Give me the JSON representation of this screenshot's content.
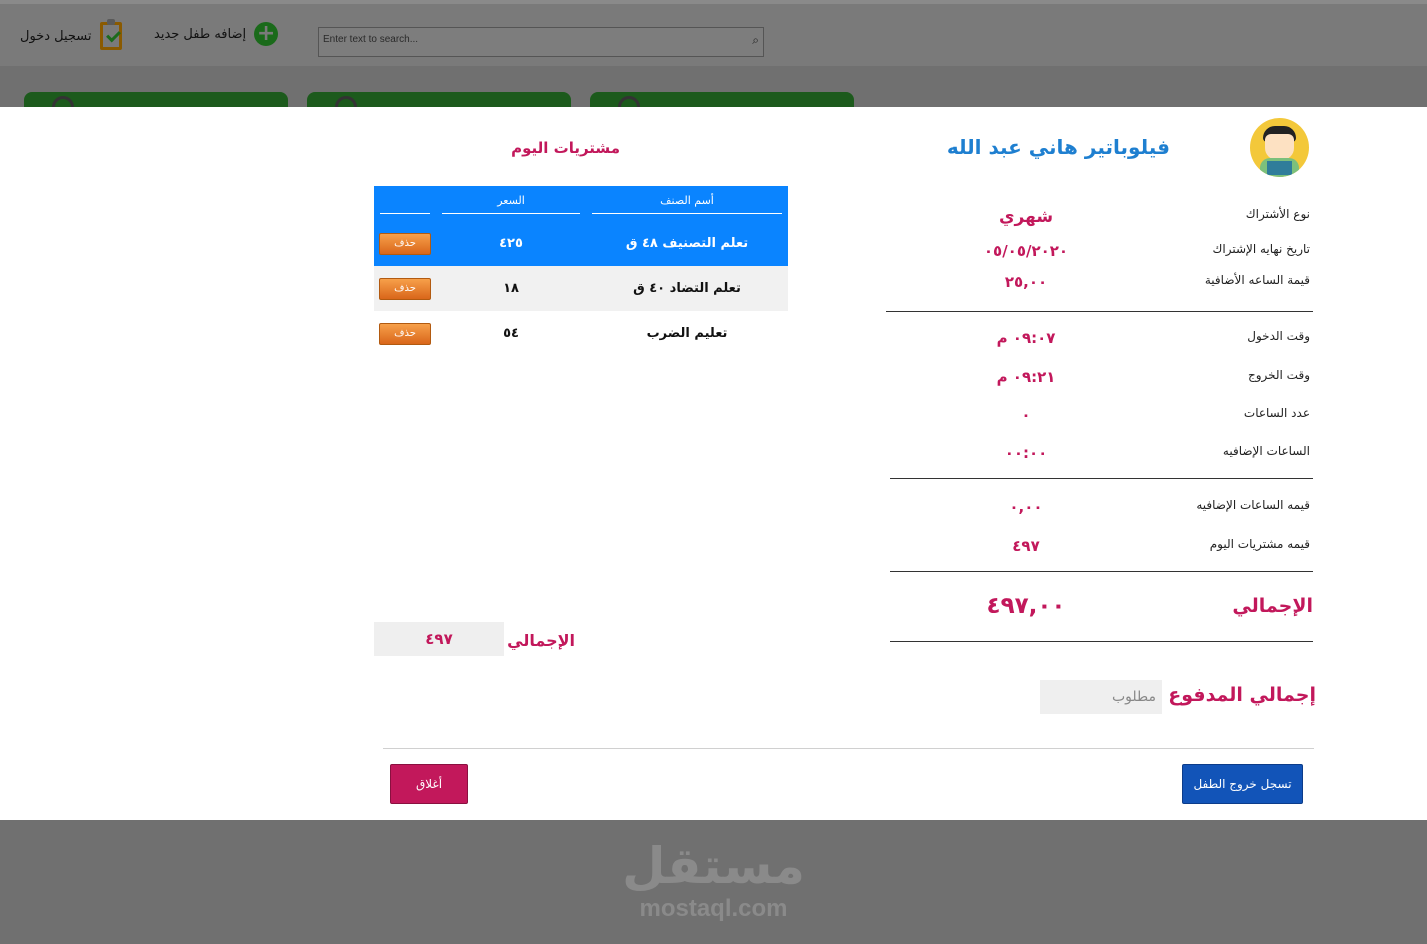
{
  "toolbar": {
    "login_label": "تسجيل دخول",
    "add_child_label": "إضافه طفل جديد",
    "search_placeholder": "Enter text to search..."
  },
  "child": {
    "name": "فيلوباتير  هاني عبد الله"
  },
  "info": {
    "subscription_type_label": "نوع الأشتراك",
    "subscription_type_value": "شهري",
    "subscription_end_label": "تاريخ نهايه الإشتراك",
    "subscription_end_value": "٠٥/٠٥/٢٠٢٠",
    "extra_hour_price_label": "قيمة الساعه الأضافية",
    "extra_hour_price_value": "٢٥,٠٠",
    "entry_time_label": "وقت الدخول",
    "entry_time_value": "٠٩:٠٧ م",
    "exit_time_label": "وقت الخروج",
    "exit_time_value": "٠٩:٢١ م",
    "hours_count_label": "عدد الساعات",
    "hours_count_value": "٠",
    "extra_hours_label": "الساعات الإضافيه",
    "extra_hours_value": "٠٠:٠٠",
    "extra_hours_cost_label": "قيمه الساعات الإضافيه",
    "extra_hours_cost_value": "٠,٠٠",
    "purchases_cost_label": "قيمه مشتريات اليوم",
    "purchases_cost_value": "٤٩٧",
    "total_label": "الإجمالي",
    "total_value": "٤٩٧,٠٠",
    "paid_label": "إجمالي المدفوع",
    "paid_placeholder": "مطلوب"
  },
  "purchases": {
    "title": "مشتريات اليوم",
    "headers": {
      "name": "أسم الصنف",
      "price": "السعر",
      "action": ""
    },
    "rows": [
      {
        "name": "تعلم التصنيف ٤٨ ق",
        "price": "٤٢٥",
        "delete": "حذف"
      },
      {
        "name": "تعلم التضاد ٤٠ ق",
        "price": "١٨",
        "delete": "حذف"
      },
      {
        "name": "تعليم الضرب",
        "price": "٥٤",
        "delete": "حذف"
      }
    ],
    "total_label": "الإجمالي",
    "total_value": "٤٩٧"
  },
  "buttons": {
    "close": "أغلاق",
    "checkout": "تسجل خروج الطفل"
  },
  "watermark": {
    "arabic": "مستقل",
    "latin": "mostaql.com"
  },
  "colors": {
    "accent_pink": "#c2185b",
    "table_header_blue": "#0a84ff",
    "checkout_blue": "#1254b8",
    "name_blue": "#1e7fd0",
    "delete_orange": "#e8782a"
  }
}
